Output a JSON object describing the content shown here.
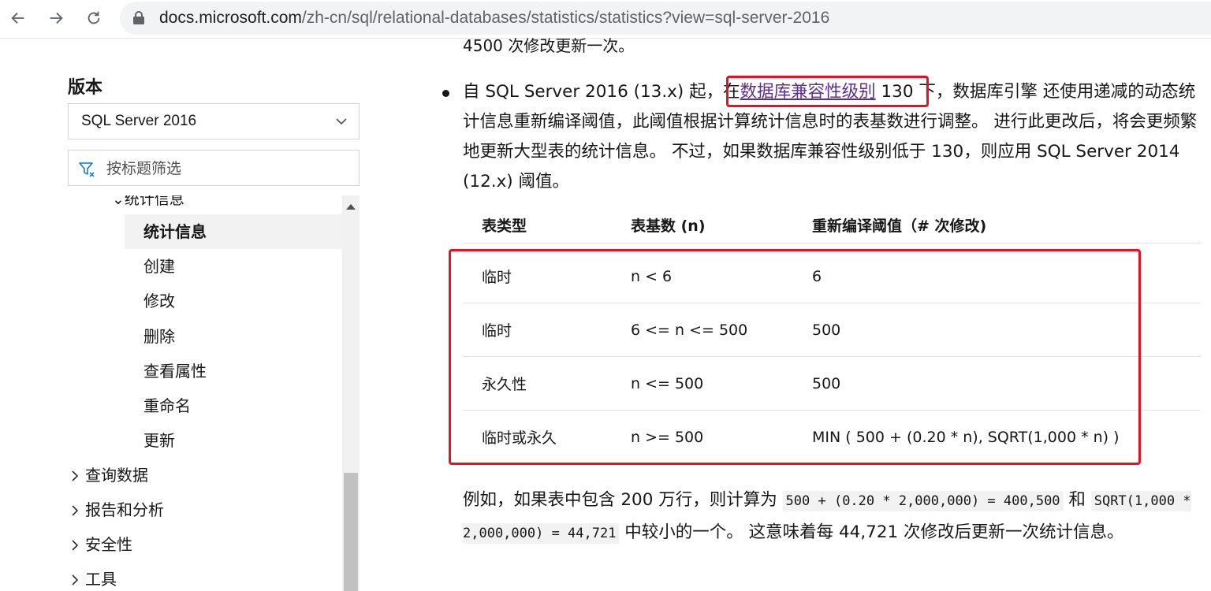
{
  "browser": {
    "url_domain": "docs.microsoft.com",
    "url_path": "/zh-cn/sql/relational-databases/statistics/statistics?view=sql-server-2016"
  },
  "sidebar": {
    "version_label": "版本",
    "version_selected": "SQL Server 2016",
    "filter_placeholder": "按标题筛选",
    "parent_item": "统计信息",
    "items": [
      {
        "label": "统计信息",
        "active": true
      },
      {
        "label": "创建"
      },
      {
        "label": "修改"
      },
      {
        "label": "删除"
      },
      {
        "label": "查看属性"
      },
      {
        "label": "重命名"
      },
      {
        "label": "更新"
      }
    ],
    "groups": [
      {
        "label": "查询数据"
      },
      {
        "label": "报告和分析"
      },
      {
        "label": "安全性"
      },
      {
        "label": "工具"
      }
    ]
  },
  "main": {
    "top_text": "4500 次修改更新一次。",
    "bullet": {
      "prefix": "自 SQL Server 2016 (13.x) 起，在",
      "link": "数据库兼容性级别",
      "link_suffix": " 130",
      "rest": " 下，数据库引擎 还使用递减的动态统计信息重新编译阈值，此阈值根据计算统计信息时的表基数进行调整。 进行此更改后，将会更频繁地更新大型表的统计信息。 不过，如果数据库兼容性级别低于 130，则应用 SQL Server 2014 (12.x) 阈值。"
    },
    "table": {
      "headers": [
        "表类型",
        "表基数 (n)",
        "重新编译阈值（# 次修改)"
      ],
      "rows": [
        [
          "临时",
          "n < 6",
          "6"
        ],
        [
          "临时",
          "6 <= n <= 500",
          "500"
        ],
        [
          "永久性",
          "n <= 500",
          "500"
        ],
        [
          "临时或永久",
          "n >= 500",
          "MIN ( 500 + (0.20 * n), SQRT(1,000 * n) )"
        ]
      ]
    },
    "example": {
      "text1": "例如，如果表中包含 200 万行，则计算为 ",
      "code1": "500 + (0.20 * 2,000,000) = 400,500",
      "text2": " 和 ",
      "code2": "SQRT(1,000 * 2,000,000) = 44,721",
      "text3": " 中较小的一个。 这意味着每 44,721 次修改后更新一次统计信息。"
    }
  }
}
